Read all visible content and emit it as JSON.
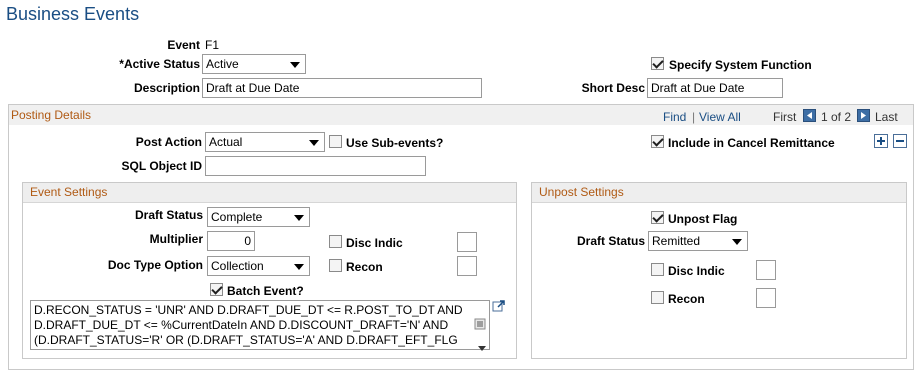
{
  "page": {
    "title": "Business Events"
  },
  "event": {
    "event_label": "Event",
    "event_value": "F1",
    "active_status_label": "*Active Status",
    "active_status_value": "Active",
    "description_label": "Description",
    "description_value": "Draft at Due Date",
    "specify_system_function_label": "Specify System Function",
    "short_desc_label": "Short Desc",
    "short_desc_value": "Draft at Due Date"
  },
  "posting": {
    "header": "Posting Details",
    "find_link": "Find",
    "separator": "|",
    "view_all_link": "View All",
    "first_label": "First",
    "page_counter": "1 of 2",
    "last_label": "Last",
    "post_action_label": "Post Action",
    "post_action_value": "Actual",
    "use_subevents_label": "Use Sub-events?",
    "include_cancel_label": "Include in Cancel Remittance",
    "sql_object_label": "SQL Object ID",
    "sql_object_value": ""
  },
  "event_settings": {
    "header": "Event Settings",
    "draft_status_label": "Draft Status",
    "draft_status_value": "Complete",
    "multiplier_label": "Multiplier",
    "multiplier_value": "0",
    "disc_indic_label": "Disc Indic",
    "doc_type_label": "Doc Type Option",
    "doc_type_value": "Collection",
    "recon_label": "Recon",
    "batch_event_label": "Batch Event?",
    "sql_lines": [
      "D.RECON_STATUS = 'UNR' AND D.DRAFT_DUE_DT <= R.POST_TO_DT AND",
      "D.DRAFT_DUE_DT <= %CurrentDateIn AND D.DISCOUNT_DRAFT='N' AND",
      "(D.DRAFT_STATUS='R'  OR (D.DRAFT_STATUS='A'  AND D.DRAFT_EFT_FLG"
    ]
  },
  "unpost_settings": {
    "header": "Unpost Settings",
    "unpost_flag_label": "Unpost Flag",
    "draft_status_label": "Draft Status",
    "draft_status_value": "Remitted",
    "disc_indic_label": "Disc Indic",
    "recon_label": "Recon"
  },
  "colors": {
    "title": "#1a4e84",
    "section_header": "#b05a14",
    "link": "#1a4e84",
    "header_bg": "#eeeeee"
  }
}
